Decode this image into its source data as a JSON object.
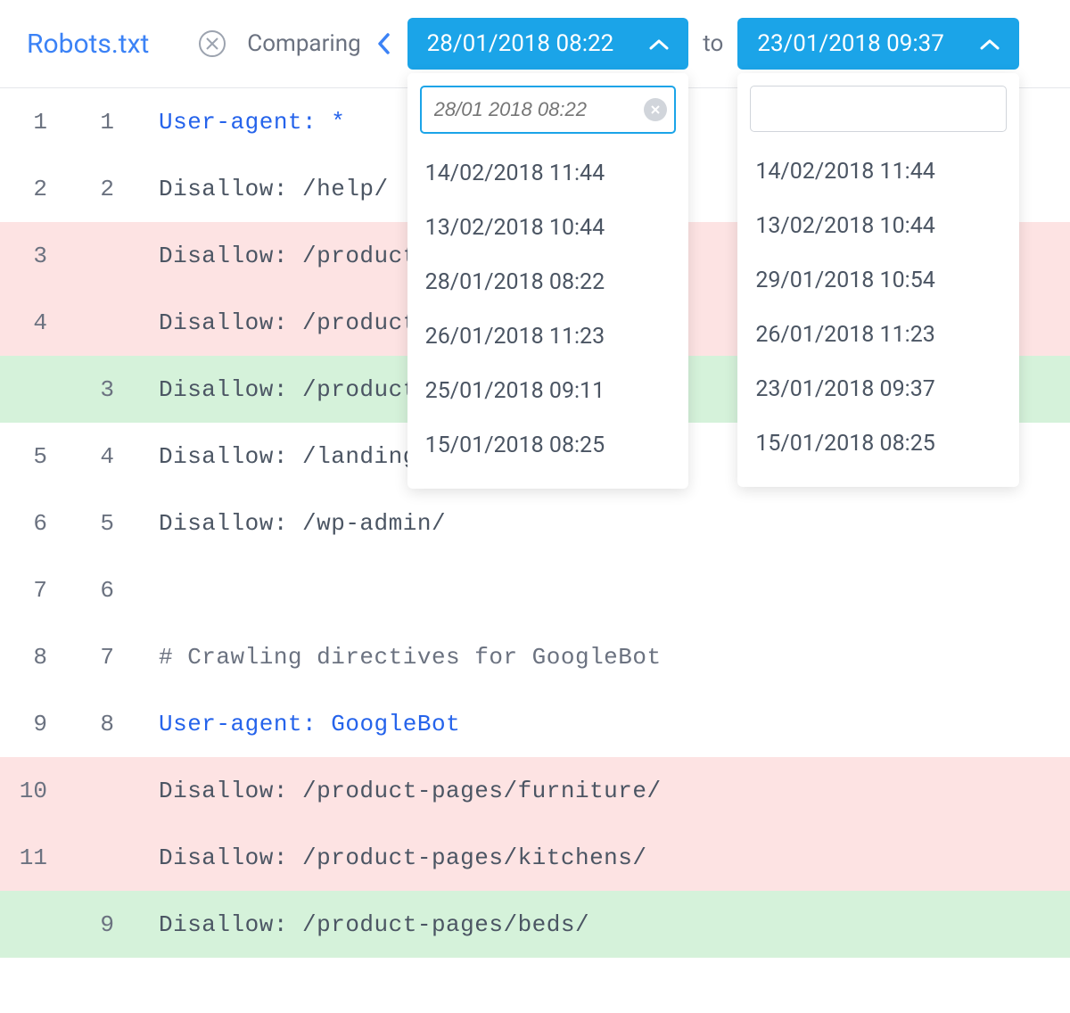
{
  "title": "Robots.txt",
  "comparing_label": "Comparing",
  "to_label": "to",
  "selector_left": {
    "value": "28/01/2018 08:22",
    "search_placeholder": "28/01 2018 08:22",
    "options": [
      "14/02/2018 11:44",
      "13/02/2018 10:44",
      "28/01/2018 08:22",
      "26/01/2018 11:23",
      "25/01/2018 09:11",
      "15/01/2018 08:25"
    ]
  },
  "selector_right": {
    "value": "23/01/2018 09:37",
    "search_placeholder": "",
    "options": [
      "14/02/2018 11:44",
      "13/02/2018 10:44",
      "29/01/2018 10:54",
      "26/01/2018 11:23",
      "23/01/2018 09:37",
      "15/01/2018 08:25"
    ]
  },
  "diff_lines": [
    {
      "left": "1",
      "right": "1",
      "status": "normal",
      "kw": "User-agent:",
      "rest": " *"
    },
    {
      "left": "2",
      "right": "2",
      "status": "normal",
      "kw": "",
      "rest": "Disallow: /help/"
    },
    {
      "left": "3",
      "right": "",
      "status": "removed",
      "kw": "",
      "rest": "Disallow: /product-"
    },
    {
      "left": "4",
      "right": "",
      "status": "removed",
      "kw": "",
      "rest": "Disallow: /product-"
    },
    {
      "left": "",
      "right": "3",
      "status": "added",
      "kw": "",
      "rest": "Disallow: /product-"
    },
    {
      "left": "5",
      "right": "4",
      "status": "normal",
      "kw": "",
      "rest": "Disallow: /landing-"
    },
    {
      "left": "6",
      "right": "5",
      "status": "normal",
      "kw": "",
      "rest": "Disallow: /wp-admin/"
    },
    {
      "left": "7",
      "right": "6",
      "status": "normal",
      "kw": "",
      "rest": ""
    },
    {
      "left": "8",
      "right": "7",
      "status": "normal",
      "kw": "",
      "rest": "",
      "comment": "# Crawling directives for GoogleBot"
    },
    {
      "left": "9",
      "right": "8",
      "status": "normal",
      "kw": "User-agent:",
      "rest": " GoogleBot"
    },
    {
      "left": "10",
      "right": "",
      "status": "removed",
      "kw": "",
      "rest": "Disallow: /product-pages/furniture/"
    },
    {
      "left": "11",
      "right": "",
      "status": "removed",
      "kw": "",
      "rest": "Disallow: /product-pages/kitchens/"
    },
    {
      "left": "",
      "right": "9",
      "status": "added",
      "kw": "",
      "rest": "Disallow: /product-pages/beds/"
    }
  ]
}
